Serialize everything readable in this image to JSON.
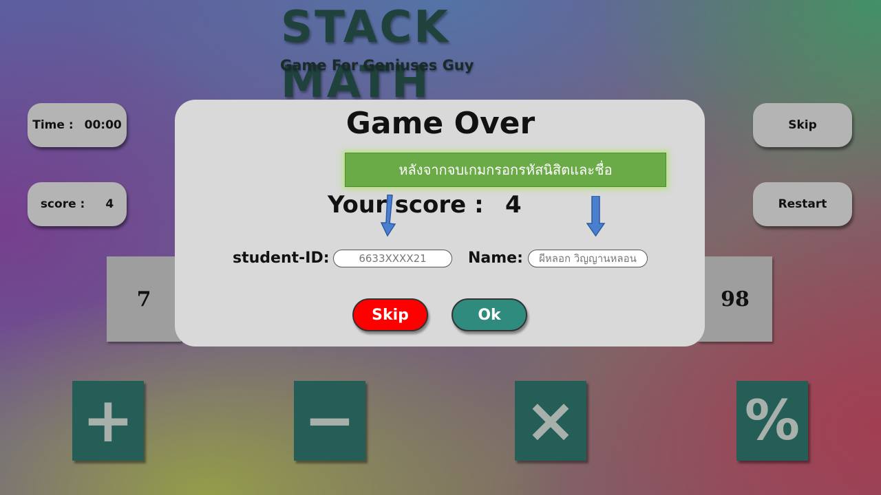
{
  "header": {
    "title": "STACK MATH",
    "subtitle": "Game For Geniuses Guy"
  },
  "stats": {
    "time_label": "Time :",
    "time_value": "00:00",
    "score_label": "score :",
    "score_value": "4"
  },
  "controls": {
    "skip_label": "Skip",
    "restart_label": "Restart"
  },
  "cards": {
    "left_value": "7",
    "right_value": "98"
  },
  "operators": [
    "+",
    "−",
    "×",
    "%"
  ],
  "modal": {
    "title": "Game Over",
    "instruction": "หลังจากจบเกมกรอกรหัสนิสิตและชื่อ",
    "score_label": "Your score :",
    "score_value": "4",
    "student_id_label": "student-ID:",
    "student_id_placeholder": "6633XXXX21",
    "name_label": "Name:",
    "name_placeholder": "ผีหลอก วิญญานหลอน",
    "skip_button": "Skip",
    "ok_button": "Ok"
  },
  "colors": {
    "modal_bg": "#d9d9d9",
    "skip_red": "#ff0000",
    "ok_teal": "#2e8b7d",
    "banner_green": "#6aab47",
    "operator_tile": "#255e57",
    "arrow_blue": "#4a7fd0"
  }
}
